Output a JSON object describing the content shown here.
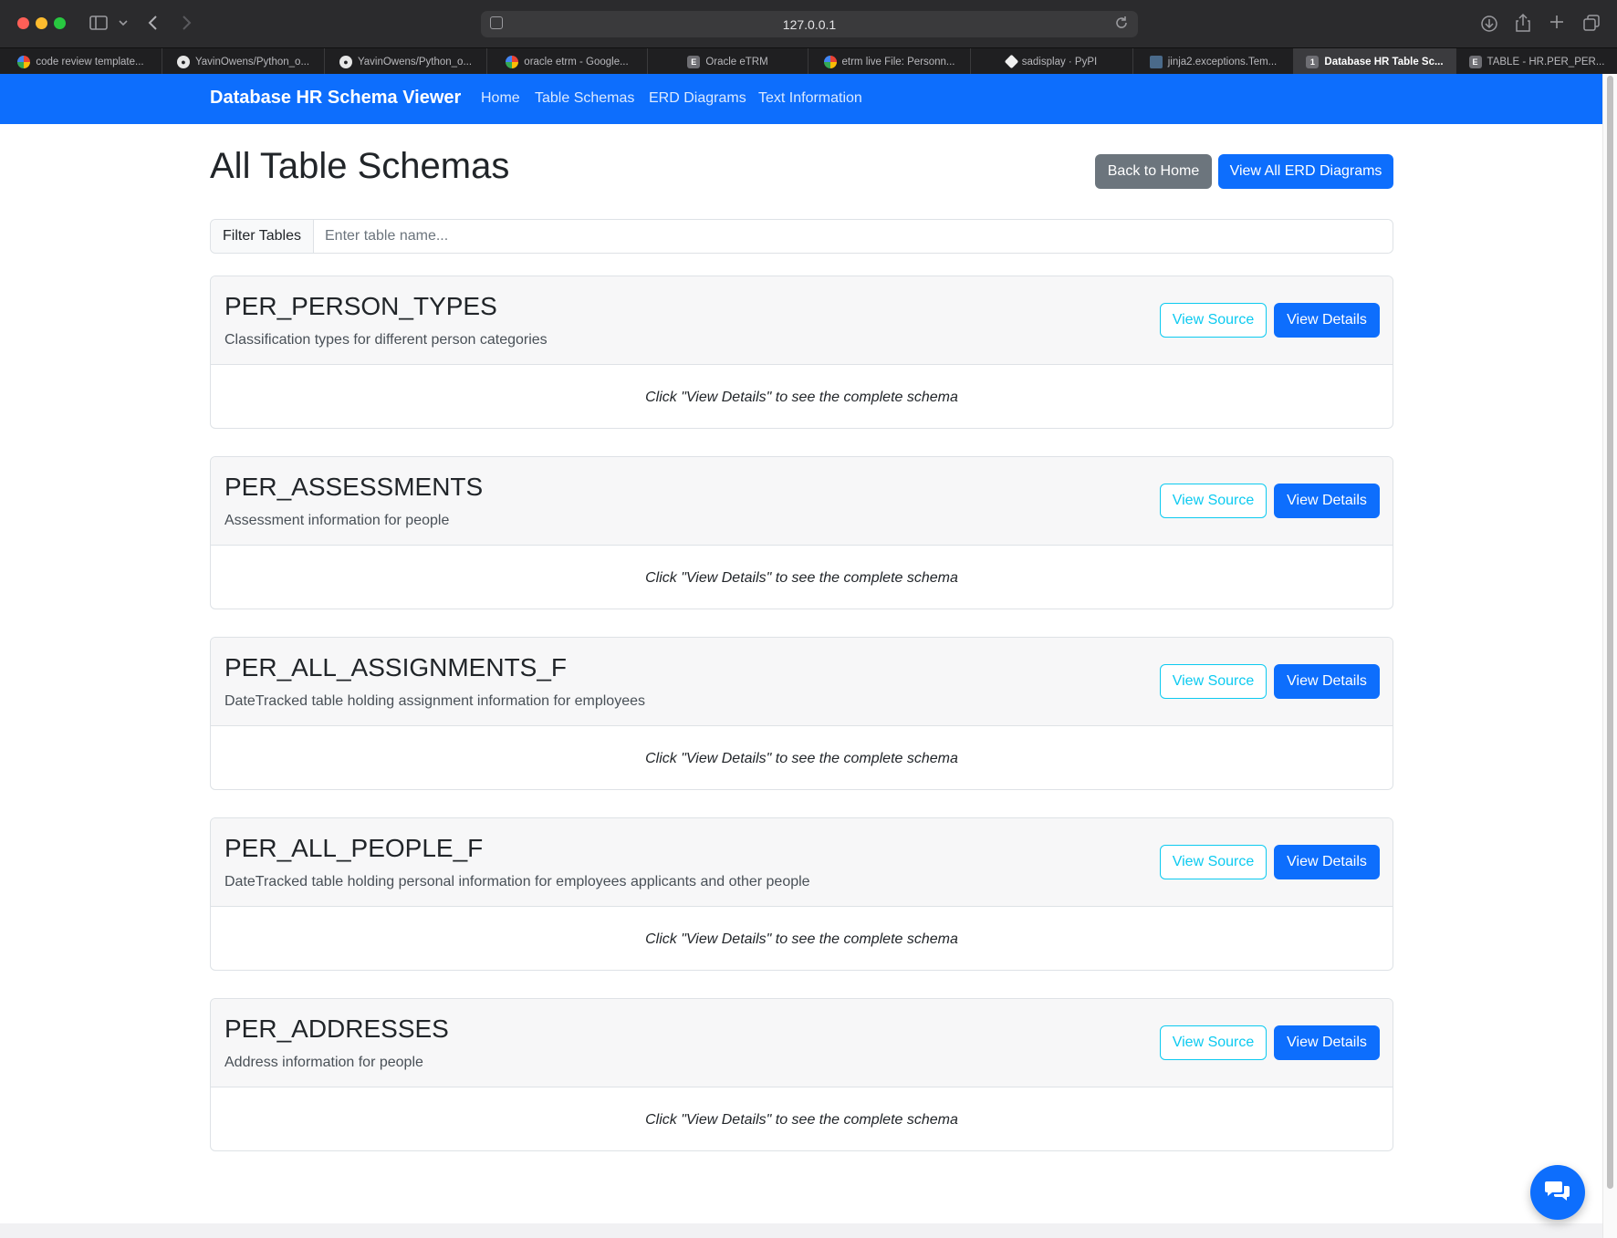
{
  "browser": {
    "url": "127.0.0.1",
    "tabs": [
      {
        "label": "code review template...",
        "favicon": "google-icon"
      },
      {
        "label": "YavinOwens/Python_o...",
        "favicon": "github-icon"
      },
      {
        "label": "YavinOwens/Python_o...",
        "favicon": "github-icon"
      },
      {
        "label": "oracle etrm - Google...",
        "favicon": "google-icon"
      },
      {
        "label": "Oracle eTRM",
        "favicon": "e-icon",
        "favicon_text": "E"
      },
      {
        "label": "etrm live File: Personn...",
        "favicon": "google-icon"
      },
      {
        "label": "sadisplay · PyPI",
        "favicon": "pypi-icon"
      },
      {
        "label": "jinja2.exceptions.Tem...",
        "favicon": "terminal-icon"
      },
      {
        "label": "Database HR Table Sc...",
        "favicon": "number-icon",
        "favicon_text": "1",
        "active": true
      },
      {
        "label": "TABLE - HR.PER_PER...",
        "favicon": "e-icon",
        "favicon_text": "E"
      }
    ]
  },
  "navbar": {
    "brand": "Database HR Schema Viewer",
    "links": [
      "Home",
      "Table Schemas",
      "ERD Diagrams",
      "Text Information"
    ]
  },
  "page": {
    "title": "All Table Schemas",
    "back_button": "Back to Home",
    "erd_button": "View All ERD Diagrams"
  },
  "filter": {
    "label": "Filter Tables",
    "placeholder": "Enter table name..."
  },
  "tables": [
    {
      "name": "PER_PERSON_TYPES",
      "description": "Classification types for different person categories",
      "source_label": "View Source",
      "details_label": "View Details",
      "body": "Click \"View Details\" to see the complete schema"
    },
    {
      "name": "PER_ASSESSMENTS",
      "description": "Assessment information for people",
      "source_label": "View Source",
      "details_label": "View Details",
      "body": "Click \"View Details\" to see the complete schema"
    },
    {
      "name": "PER_ALL_ASSIGNMENTS_F",
      "description": "DateTracked table holding assignment information for employees",
      "source_label": "View Source",
      "details_label": "View Details",
      "body": "Click \"View Details\" to see the complete schema"
    },
    {
      "name": "PER_ALL_PEOPLE_F",
      "description": "DateTracked table holding personal information for employees applicants and other people",
      "source_label": "View Source",
      "details_label": "View Details",
      "body": "Click \"View Details\" to see the complete schema"
    },
    {
      "name": "PER_ADDRESSES",
      "description": "Address information for people",
      "source_label": "View Source",
      "details_label": "View Details",
      "body": "Click \"View Details\" to see the complete schema"
    }
  ],
  "chat": {
    "icon": "chat-bubbles-icon"
  },
  "colors": {
    "primary": "#0d6efd",
    "secondary": "#6c757d",
    "info": "#0dcaf0",
    "chrome": "#2b2b2d"
  }
}
